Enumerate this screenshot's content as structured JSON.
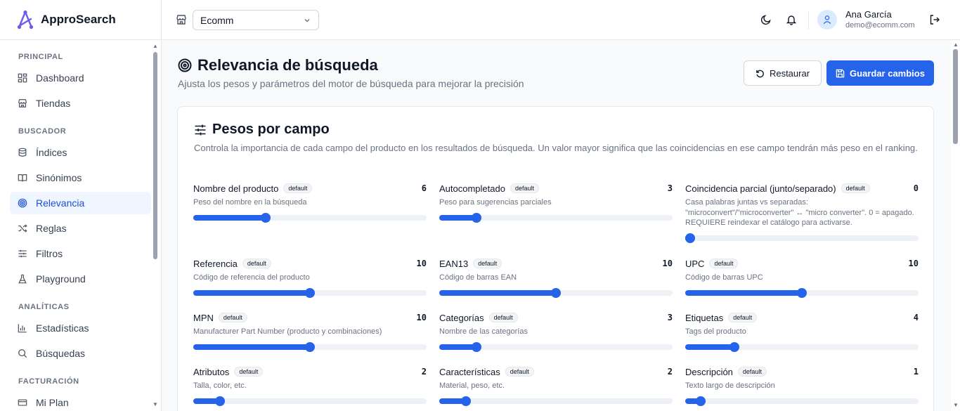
{
  "brand": {
    "name": "ApproSearch"
  },
  "sidebar": {
    "sections": [
      {
        "title": "PRINCIPAL",
        "items": [
          {
            "label": "Dashboard",
            "icon": "dashboard-icon"
          },
          {
            "label": "Tiendas",
            "icon": "store-icon"
          }
        ]
      },
      {
        "title": "BUSCADOR",
        "items": [
          {
            "label": "Índices",
            "icon": "database-icon"
          },
          {
            "label": "Sinónimos",
            "icon": "book-icon"
          },
          {
            "label": "Relevancia",
            "icon": "target-icon",
            "active": true
          },
          {
            "label": "Reglas",
            "icon": "shuffle-icon"
          },
          {
            "label": "Filtros",
            "icon": "sliders-icon"
          },
          {
            "label": "Playground",
            "icon": "flask-icon"
          }
        ]
      },
      {
        "title": "ANALÍTICAS",
        "items": [
          {
            "label": "Estadísticas",
            "icon": "bar-chart-icon"
          },
          {
            "label": "Búsquedas",
            "icon": "search-icon"
          }
        ]
      },
      {
        "title": "FACTURACIÓN",
        "items": [
          {
            "label": "Mi Plan",
            "icon": "credit-card-icon"
          }
        ]
      }
    ]
  },
  "header": {
    "store_select": "Ecomm",
    "user_name": "Ana García",
    "user_email": "demo@ecomm.com"
  },
  "page": {
    "title": "Relevancia de búsqueda",
    "subtitle": "Ajusta los pesos y parámetros del motor de búsqueda para mejorar la precisión",
    "restore_label": "Restaurar",
    "save_label": "Guardar cambios"
  },
  "card": {
    "title": "Pesos por campo",
    "description": "Controla la importancia de cada campo del producto en los resultados de búsqueda. Un valor mayor significa que las coincidencias en ese campo tendrán más peso en el ranking.",
    "badge_label": "default",
    "fields": [
      {
        "name": "Nombre del producto",
        "desc": "Peso del nombre en la búsqueda",
        "value": "6",
        "fraction": 0.31
      },
      {
        "name": "Autocompletado",
        "desc": "Peso para sugerencias parciales",
        "value": "3",
        "fraction": 0.16
      },
      {
        "name": "Coincidencia parcial (junto/separado)",
        "desc": "Casa palabras juntas vs separadas: \"microconvert\"/\"microconverter\" ↔ \"micro converter\". 0 = apagado. REQUIERE reindexar el catálogo para activarse.",
        "value": "0",
        "fraction": 0.02
      },
      {
        "name": "Referencia",
        "desc": "Código de referencia del producto",
        "value": "10",
        "fraction": 0.5
      },
      {
        "name": "EAN13",
        "desc": "Código de barras EAN",
        "value": "10",
        "fraction": 0.5
      },
      {
        "name": "UPC",
        "desc": "Código de barras UPC",
        "value": "10",
        "fraction": 0.5
      },
      {
        "name": "MPN",
        "desc": "Manufacturer Part Number (producto y combinaciones)",
        "value": "10",
        "fraction": 0.5
      },
      {
        "name": "Categorías",
        "desc": "Nombre de las categorías",
        "value": "3",
        "fraction": 0.16
      },
      {
        "name": "Etiquetas",
        "desc": "Tags del producto",
        "value": "4",
        "fraction": 0.21
      },
      {
        "name": "Atributos",
        "desc": "Talla, color, etc.",
        "value": "2",
        "fraction": 0.115
      },
      {
        "name": "Características",
        "desc": "Material, peso, etc.",
        "value": "2",
        "fraction": 0.115
      },
      {
        "name": "Descripción",
        "desc": "Texto largo de descripción",
        "value": "1",
        "fraction": 0.067
      }
    ]
  }
}
